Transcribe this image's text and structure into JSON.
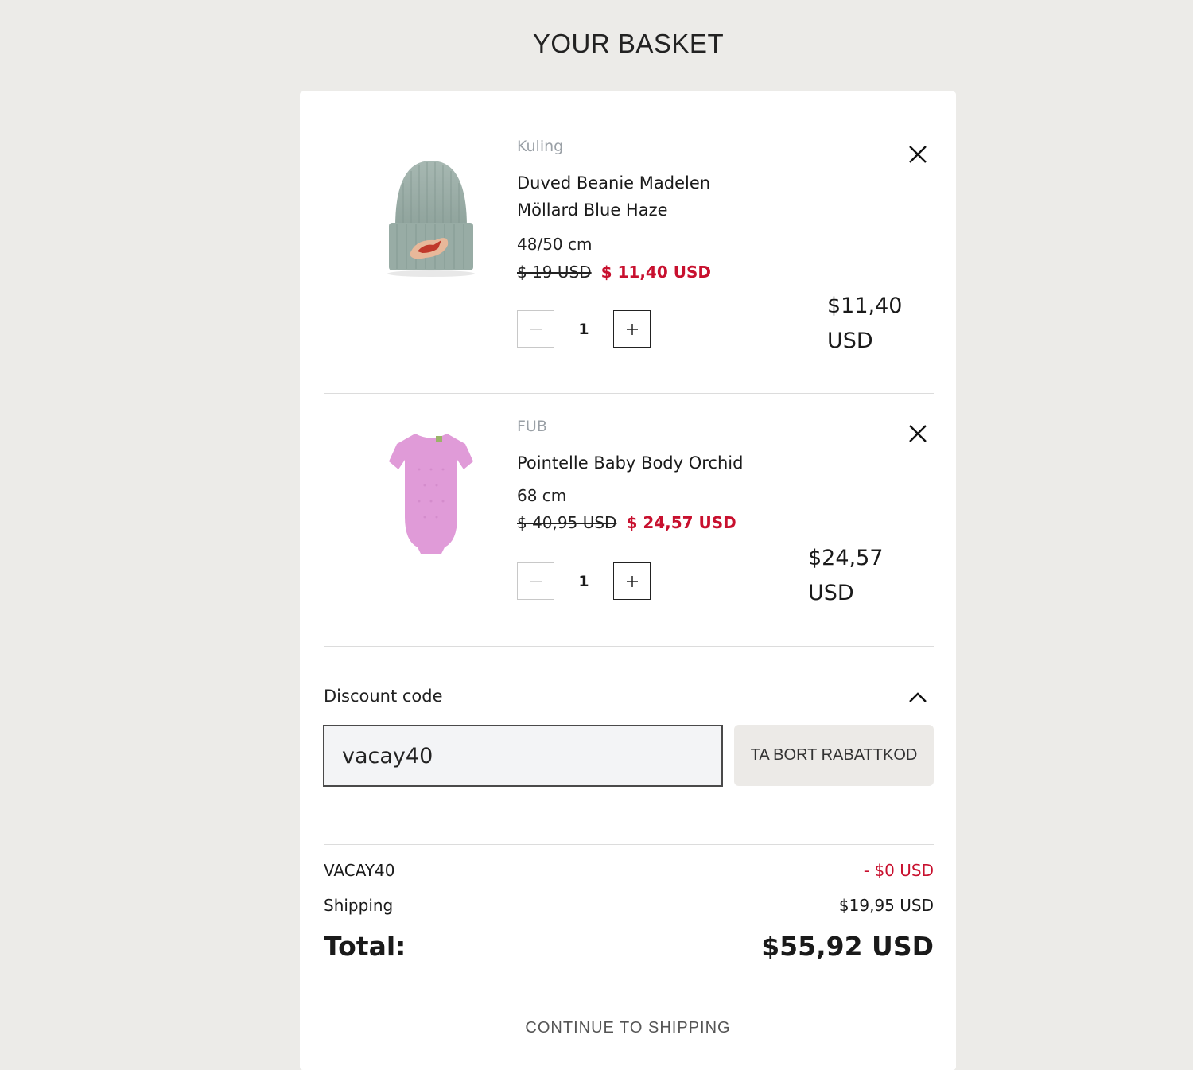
{
  "page": {
    "title": "YOUR BASKET"
  },
  "items": [
    {
      "brand": "Kuling",
      "name": "Duved Beanie Madelen Möllard Blue Haze",
      "size": "48/50 cm",
      "old_price": "$ 19 USD",
      "sale_price": "$ 11,40 USD",
      "quantity": "1",
      "line_total_amount": "$11,40",
      "line_total_currency": "USD",
      "image": "green-ribbed-beanie-with-fox-patch"
    },
    {
      "brand": "FUB",
      "name": "Pointelle Baby Body Orchid",
      "size": "68 cm",
      "old_price": "$ 40,95 USD",
      "sale_price": "$ 24,57 USD",
      "quantity": "1",
      "line_total_amount": "$24,57",
      "line_total_currency": "USD",
      "image": "pink-baby-bodysuit"
    }
  ],
  "discount": {
    "label": "Discount code",
    "value": "vacay40",
    "remove_label": "TA BORT RABATTKOD"
  },
  "summary": {
    "code_name": "VACAY40",
    "code_amount": "- $0 USD",
    "shipping_label": "Shipping",
    "shipping_amount": "$19,95 USD",
    "total_label": "Total:",
    "total_amount": "$55,92 USD"
  },
  "actions": {
    "continue_label": "CONTINUE TO SHIPPING"
  },
  "colors": {
    "sale": "#c8102e",
    "background": "#ecebe8",
    "brand_text": "#9aa0a6"
  }
}
